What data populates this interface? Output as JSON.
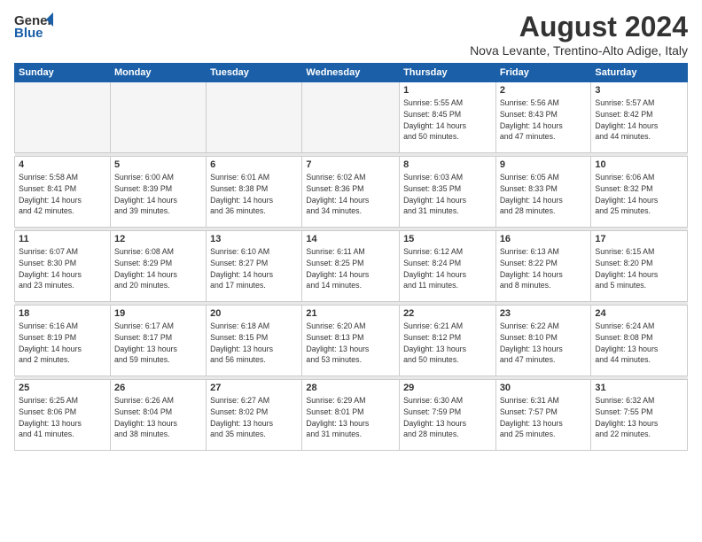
{
  "header": {
    "logo_line1": "General",
    "logo_line2": "Blue",
    "title": "August 2024",
    "subtitle": "Nova Levante, Trentino-Alto Adige, Italy"
  },
  "calendar": {
    "days_of_week": [
      "Sunday",
      "Monday",
      "Tuesday",
      "Wednesday",
      "Thursday",
      "Friday",
      "Saturday"
    ],
    "weeks": [
      {
        "days": [
          {
            "num": "",
            "info": ""
          },
          {
            "num": "",
            "info": ""
          },
          {
            "num": "",
            "info": ""
          },
          {
            "num": "",
            "info": ""
          },
          {
            "num": "1",
            "info": "Sunrise: 5:55 AM\nSunset: 8:45 PM\nDaylight: 14 hours\nand 50 minutes."
          },
          {
            "num": "2",
            "info": "Sunrise: 5:56 AM\nSunset: 8:43 PM\nDaylight: 14 hours\nand 47 minutes."
          },
          {
            "num": "3",
            "info": "Sunrise: 5:57 AM\nSunset: 8:42 PM\nDaylight: 14 hours\nand 44 minutes."
          }
        ]
      },
      {
        "days": [
          {
            "num": "4",
            "info": "Sunrise: 5:58 AM\nSunset: 8:41 PM\nDaylight: 14 hours\nand 42 minutes."
          },
          {
            "num": "5",
            "info": "Sunrise: 6:00 AM\nSunset: 8:39 PM\nDaylight: 14 hours\nand 39 minutes."
          },
          {
            "num": "6",
            "info": "Sunrise: 6:01 AM\nSunset: 8:38 PM\nDaylight: 14 hours\nand 36 minutes."
          },
          {
            "num": "7",
            "info": "Sunrise: 6:02 AM\nSunset: 8:36 PM\nDaylight: 14 hours\nand 34 minutes."
          },
          {
            "num": "8",
            "info": "Sunrise: 6:03 AM\nSunset: 8:35 PM\nDaylight: 14 hours\nand 31 minutes."
          },
          {
            "num": "9",
            "info": "Sunrise: 6:05 AM\nSunset: 8:33 PM\nDaylight: 14 hours\nand 28 minutes."
          },
          {
            "num": "10",
            "info": "Sunrise: 6:06 AM\nSunset: 8:32 PM\nDaylight: 14 hours\nand 25 minutes."
          }
        ]
      },
      {
        "days": [
          {
            "num": "11",
            "info": "Sunrise: 6:07 AM\nSunset: 8:30 PM\nDaylight: 14 hours\nand 23 minutes."
          },
          {
            "num": "12",
            "info": "Sunrise: 6:08 AM\nSunset: 8:29 PM\nDaylight: 14 hours\nand 20 minutes."
          },
          {
            "num": "13",
            "info": "Sunrise: 6:10 AM\nSunset: 8:27 PM\nDaylight: 14 hours\nand 17 minutes."
          },
          {
            "num": "14",
            "info": "Sunrise: 6:11 AM\nSunset: 8:25 PM\nDaylight: 14 hours\nand 14 minutes."
          },
          {
            "num": "15",
            "info": "Sunrise: 6:12 AM\nSunset: 8:24 PM\nDaylight: 14 hours\nand 11 minutes."
          },
          {
            "num": "16",
            "info": "Sunrise: 6:13 AM\nSunset: 8:22 PM\nDaylight: 14 hours\nand 8 minutes."
          },
          {
            "num": "17",
            "info": "Sunrise: 6:15 AM\nSunset: 8:20 PM\nDaylight: 14 hours\nand 5 minutes."
          }
        ]
      },
      {
        "days": [
          {
            "num": "18",
            "info": "Sunrise: 6:16 AM\nSunset: 8:19 PM\nDaylight: 14 hours\nand 2 minutes."
          },
          {
            "num": "19",
            "info": "Sunrise: 6:17 AM\nSunset: 8:17 PM\nDaylight: 13 hours\nand 59 minutes."
          },
          {
            "num": "20",
            "info": "Sunrise: 6:18 AM\nSunset: 8:15 PM\nDaylight: 13 hours\nand 56 minutes."
          },
          {
            "num": "21",
            "info": "Sunrise: 6:20 AM\nSunset: 8:13 PM\nDaylight: 13 hours\nand 53 minutes."
          },
          {
            "num": "22",
            "info": "Sunrise: 6:21 AM\nSunset: 8:12 PM\nDaylight: 13 hours\nand 50 minutes."
          },
          {
            "num": "23",
            "info": "Sunrise: 6:22 AM\nSunset: 8:10 PM\nDaylight: 13 hours\nand 47 minutes."
          },
          {
            "num": "24",
            "info": "Sunrise: 6:24 AM\nSunset: 8:08 PM\nDaylight: 13 hours\nand 44 minutes."
          }
        ]
      },
      {
        "days": [
          {
            "num": "25",
            "info": "Sunrise: 6:25 AM\nSunset: 8:06 PM\nDaylight: 13 hours\nand 41 minutes."
          },
          {
            "num": "26",
            "info": "Sunrise: 6:26 AM\nSunset: 8:04 PM\nDaylight: 13 hours\nand 38 minutes."
          },
          {
            "num": "27",
            "info": "Sunrise: 6:27 AM\nSunset: 8:02 PM\nDaylight: 13 hours\nand 35 minutes."
          },
          {
            "num": "28",
            "info": "Sunrise: 6:29 AM\nSunset: 8:01 PM\nDaylight: 13 hours\nand 31 minutes."
          },
          {
            "num": "29",
            "info": "Sunrise: 6:30 AM\nSunset: 7:59 PM\nDaylight: 13 hours\nand 28 minutes."
          },
          {
            "num": "30",
            "info": "Sunrise: 6:31 AM\nSunset: 7:57 PM\nDaylight: 13 hours\nand 25 minutes."
          },
          {
            "num": "31",
            "info": "Sunrise: 6:32 AM\nSunset: 7:55 PM\nDaylight: 13 hours\nand 22 minutes."
          }
        ]
      }
    ]
  }
}
